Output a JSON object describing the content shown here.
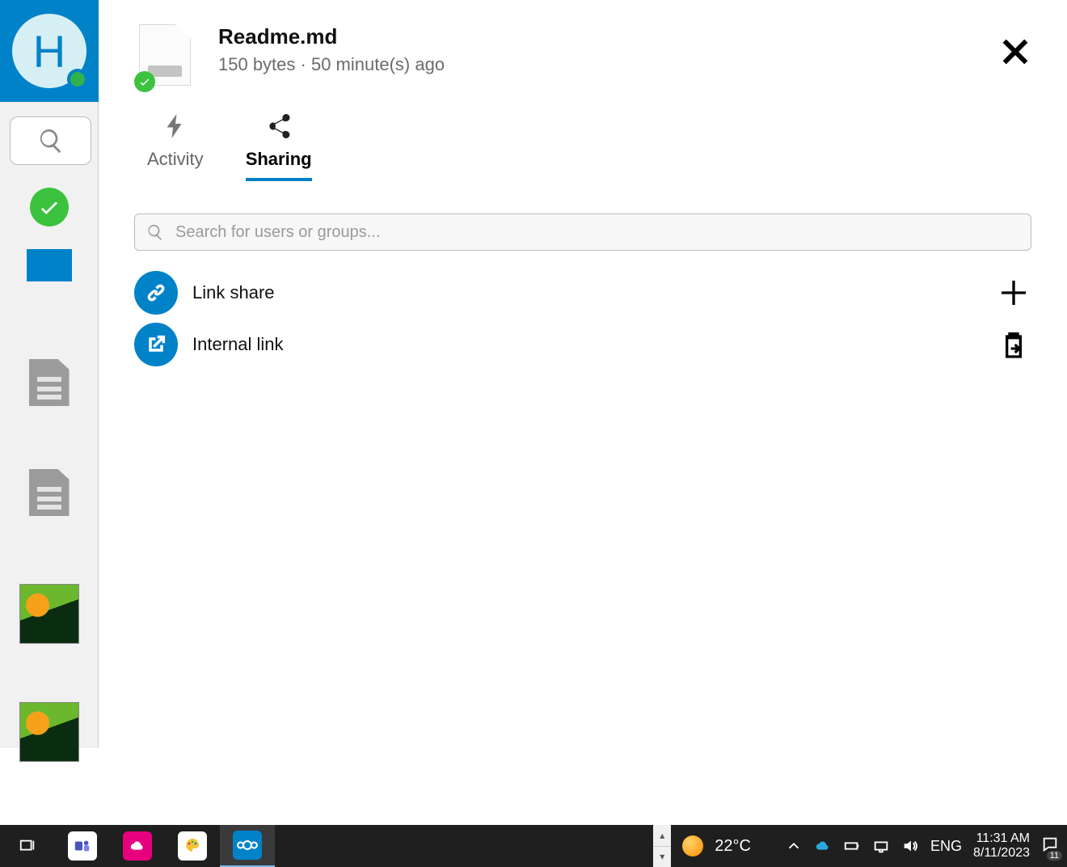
{
  "avatar": {
    "letter": "H"
  },
  "file": {
    "name": "Readme.md",
    "size": "150 bytes",
    "sep": " · ",
    "age": "50 minute(s) ago"
  },
  "tabs": {
    "activity": "Activity",
    "sharing": "Sharing"
  },
  "search": {
    "placeholder": "Search for users or groups..."
  },
  "share": {
    "link_share": "Link share",
    "internal_link": "Internal link"
  },
  "taskbar": {
    "temp": "22°C",
    "lang": "ENG",
    "time": "11:31 AM",
    "date": "8/11/2023",
    "notif_count": "11"
  }
}
